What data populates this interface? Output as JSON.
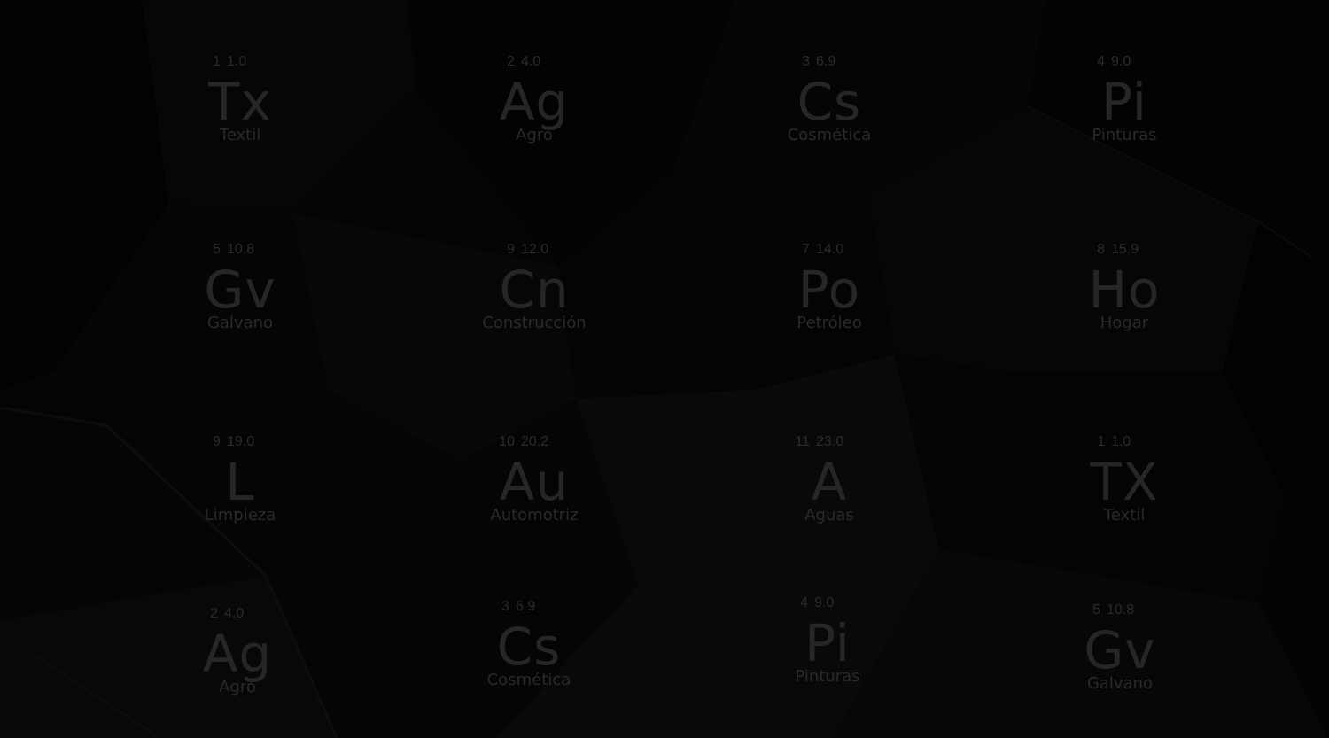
{
  "colors": {
    "background": "#040404",
    "text": "#272727",
    "shape_dark": "#010101",
    "shape_light": "#0b0b0b"
  },
  "elements": [
    {
      "number": "1",
      "mass": "1.0",
      "symbol": "Tx",
      "name": "Textil"
    },
    {
      "number": "2",
      "mass": "4.0",
      "symbol": "Ag",
      "name": "Agro"
    },
    {
      "number": "3",
      "mass": "6.9",
      "symbol": "Cs",
      "name": "Cosmética"
    },
    {
      "number": "4",
      "mass": "9.0",
      "symbol": "Pi",
      "name": "Pinturas"
    },
    {
      "number": "5",
      "mass": "10.8",
      "symbol": "Gv",
      "name": "Galvano"
    },
    {
      "number": "9",
      "mass": "12.0",
      "symbol": "Cn",
      "name": "Construcción"
    },
    {
      "number": "7",
      "mass": "14.0",
      "symbol": "Po",
      "name": "Petróleo"
    },
    {
      "number": "8",
      "mass": "15.9",
      "symbol": "Ho",
      "name": "Hogar"
    },
    {
      "number": "9",
      "mass": "19.0",
      "symbol": "L",
      "name": "Limpieza"
    },
    {
      "number": "10",
      "mass": "20.2",
      "symbol": "Au",
      "name": "Automotriz"
    },
    {
      "number": "11",
      "mass": "23.0",
      "symbol": "A",
      "name": "Aguas"
    },
    {
      "number": "1",
      "mass": "1.0",
      "symbol": "TX",
      "name": "Textil"
    },
    {
      "number": "2",
      "mass": "4.0",
      "symbol": "Ag",
      "name": "Agro"
    },
    {
      "number": "3",
      "mass": "6.9",
      "symbol": "Cs",
      "name": "Cosmética"
    },
    {
      "number": "4",
      "mass": "9.0",
      "symbol": "Pi",
      "name": "Pinturas"
    },
    {
      "number": "5",
      "mass": "10.8",
      "symbol": "Gv",
      "name": "Galvano"
    }
  ]
}
